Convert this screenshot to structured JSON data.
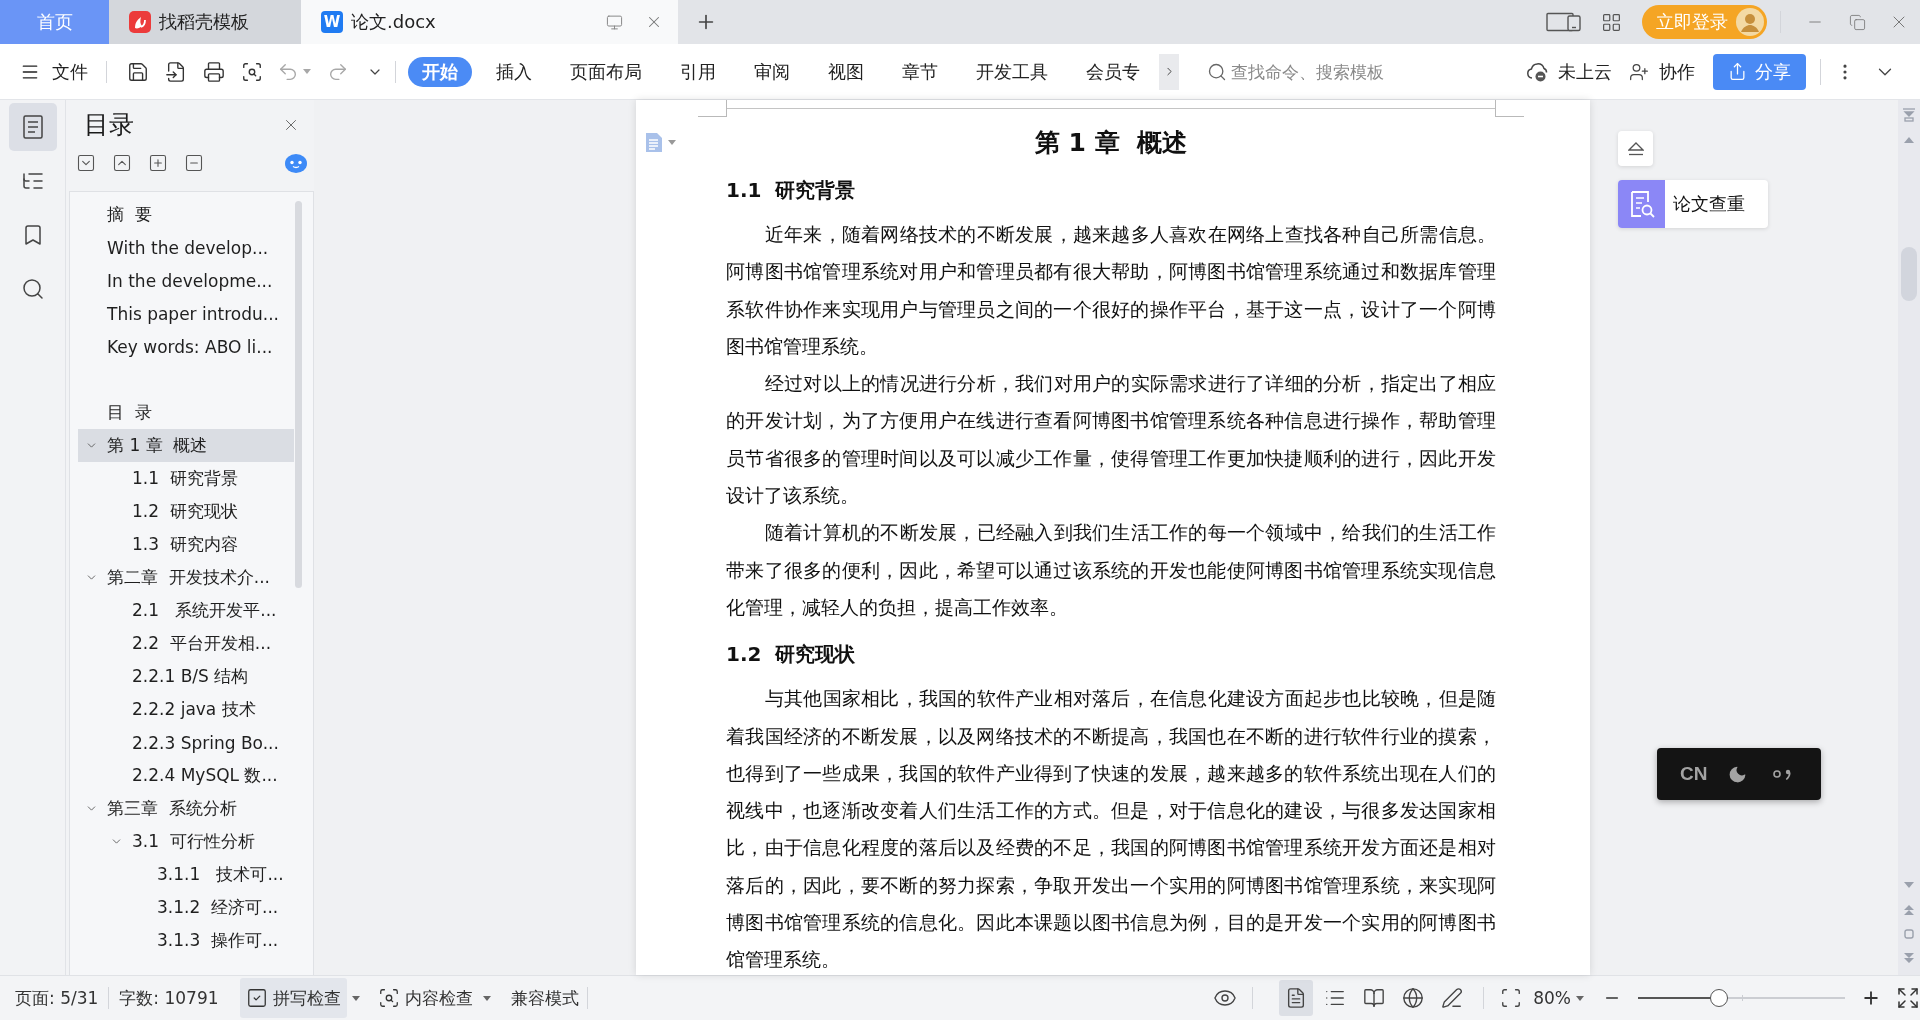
{
  "tabs": [
    {
      "kind": "home",
      "label": "首页",
      "selected": false
    },
    {
      "kind": "template",
      "label": "找稻壳模板",
      "selected": false
    },
    {
      "kind": "document",
      "logo": "W",
      "label": "论文.docx",
      "selected": true
    }
  ],
  "account": {
    "login": "立即登录"
  },
  "toolbar": {
    "file_menu": "文件",
    "history": [
      {
        "kind": "undo",
        "disabled": true
      },
      {
        "kind": "redo",
        "disabled": true
      }
    ],
    "ribbon_tabs": [
      {
        "label": "开始",
        "selected": true
      },
      {
        "label": "插入",
        "selected": false
      },
      {
        "label": "页面布局",
        "selected": false
      },
      {
        "label": "引用",
        "selected": false
      },
      {
        "label": "审阅",
        "selected": false
      },
      {
        "label": "视图",
        "selected": false
      },
      {
        "label": "章节",
        "selected": false
      },
      {
        "label": "开发工具",
        "selected": false
      },
      {
        "label": "会员专",
        "selected": false
      }
    ],
    "search": {
      "placeholder": "查找命令、搜索模板"
    },
    "cloud_status": "未上云",
    "collaborate": "协作",
    "share": "分享"
  },
  "nav_rail": [
    {
      "kind": "toc",
      "selected": true
    },
    {
      "kind": "navigation",
      "selected": false
    },
    {
      "kind": "bookmark",
      "selected": false
    },
    {
      "kind": "search",
      "selected": false
    }
  ],
  "toc_panel": {
    "title": "目录",
    "groups": [
      {
        "items": [
          {
            "label": "摘  要",
            "selected": false
          },
          {
            "label": "With the develop...",
            "selected": false
          },
          {
            "label": "In the developme...",
            "selected": false
          },
          {
            "label": "This paper introdu...",
            "selected": false
          },
          {
            "label": "Key words: ABO li...",
            "selected": false
          }
        ]
      },
      {
        "items": [
          {
            "label": "目  录",
            "selected": false
          },
          {
            "label": "第 1 章  概述",
            "selected": true,
            "expanded": true,
            "children": [
              {
                "label": "1.1  研究背景",
                "selected": false
              },
              {
                "label": "1.2  研究现状",
                "selected": false
              },
              {
                "label": "1.3  研究内容",
                "selected": false
              }
            ]
          },
          {
            "label": "第二章  开发技术介...",
            "selected": false,
            "expanded": true,
            "children": [
              {
                "label": "2.1   系统开发平...",
                "selected": false
              },
              {
                "label": "2.2  平台开发相...",
                "selected": false
              },
              {
                "label": "2.2.1 B/S 结构",
                "selected": false
              },
              {
                "label": "2.2.2 java 技术",
                "selected": false
              },
              {
                "label": "2.2.3 Spring Bo...",
                "selected": false
              },
              {
                "label": "2.2.4 MySQL 数...",
                "selected": false
              }
            ]
          },
          {
            "label": "第三章  系统分析",
            "selected": false,
            "expanded": true,
            "children": [
              {
                "label": "3.1  可行性分析",
                "selected": false,
                "expanded": true,
                "children": [
                  {
                    "label": "3.1.1   技术可...",
                    "selected": false
                  },
                  {
                    "label": "3.1.2  经济可...",
                    "selected": false
                  },
                  {
                    "label": "3.1.3  操作可...",
                    "selected": false
                  }
                ]
              }
            ]
          }
        ]
      }
    ]
  },
  "document": {
    "blocks": [
      {
        "kind": "chapter_title",
        "text": "第 1 章  概述"
      },
      {
        "kind": "section_heading",
        "text": "1.1  研究背景"
      },
      {
        "kind": "paragraph",
        "lines": [
          "近年来，随着网络技术的不断发展，越来越多人喜欢在网络上查找各种自己所需信息。",
          "阿博图书馆管理系统对用户和管理员都有很大帮助，阿博图书馆管理系统通过和数据库管理",
          "系软件协作来实现用户与管理员之间的一个很好的操作平台，基于这一点，设计了一个阿博",
          "图书馆管理系统。"
        ]
      },
      {
        "kind": "paragraph",
        "lines": [
          "经过对以上的情况进行分析，我们对用户的实际需求进行了详细的分析，指定出了相应",
          "的开发计划，为了方便用户在线进行查看阿博图书馆管理系统各种信息进行操作，帮助管理",
          "员节省很多的管理时间以及可以减少工作量，使得管理工作更加快捷顺利的进行，因此开发",
          "设计了该系统。"
        ]
      },
      {
        "kind": "paragraph",
        "lines": [
          "随着计算机的不断发展，已经融入到我们生活工作的每一个领域中，给我们的生活工作",
          "带来了很多的便利，因此，希望可以通过该系统的开发也能使阿博图书馆管理系统实现信息",
          "化管理，减轻人的负担，提高工作效率。"
        ]
      },
      {
        "kind": "section_heading",
        "text": "1.2  研究现状"
      },
      {
        "kind": "paragraph",
        "lines": [
          "与其他国家相比，我国的软件产业相对落后，在信息化建设方面起步也比较晚，但是随",
          "着我国经济的不断发展，以及网络技术的不断提高，我国也在不断的进行软件行业的摸索，",
          "也得到了一些成果，我国的软件产业得到了快速的发展，越来越多的软件系统出现在人们的",
          "视线中，也逐渐改变着人们生活工作的方式。但是，对于信息化的建设，与很多发达国家相",
          "比，由于信息化程度的落后以及经费的不足，我国的阿博图书馆管理系统开发方面还是相对",
          "落后的，因此，要不断的努力探索，争取开发出一个实用的阿博图书馆管理系统，来实现阿",
          "博图书馆管理系统的信息化。因此本课题以图书信息为例，目的是开发一个实用的阿博图书",
          "馆管理系统。"
        ]
      }
    ]
  },
  "side_tools": {
    "plagiarism_check": "论文查重"
  },
  "ime": {
    "mode": "CN"
  },
  "status_bar": {
    "page": "页面: 5/31",
    "word_count": "字数: 10791",
    "spell_check": {
      "label": "拼写检查",
      "on": true
    },
    "content_check": "内容检查",
    "compat_mode": "兼容模式",
    "views": [
      {
        "kind": "page",
        "selected": true
      },
      {
        "kind": "outline",
        "selected": false
      },
      {
        "kind": "reading",
        "selected": false
      },
      {
        "kind": "web",
        "selected": false
      },
      {
        "kind": "writing",
        "selected": false
      }
    ],
    "zoom": {
      "value": "80%",
      "level": 0.39
    }
  }
}
